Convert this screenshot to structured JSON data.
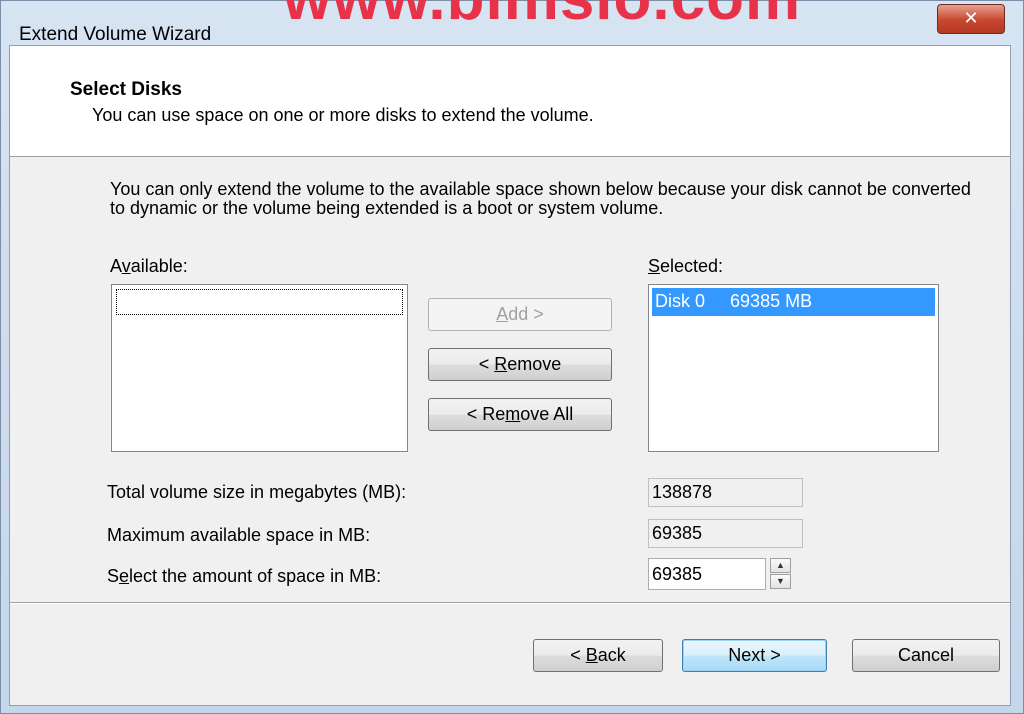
{
  "window": {
    "title": "Extend Volume Wizard",
    "watermark": "www.bimslo.com",
    "close_glyph": "✕"
  },
  "header": {
    "title": "Select Disks",
    "description": "You can use space on one or more disks to extend the volume."
  },
  "info": "You can only extend the volume to the available space shown below because your disk cannot be converted to dynamic or the volume being extended is a boot or system volume.",
  "available": {
    "label_pre": "A",
    "label_key": "v",
    "label_post": "ailable:",
    "items": []
  },
  "selected": {
    "label_key": "S",
    "label_post": "elected:",
    "items": [
      {
        "disk": "Disk 0",
        "size": "69385 MB"
      }
    ]
  },
  "buttons": {
    "add_key": "A",
    "add_post": "dd >",
    "remove_pre": "< ",
    "remove_key": "R",
    "remove_post": "emove",
    "remove_all_pre": "< Re",
    "remove_all_key": "m",
    "remove_all_post": "ove All",
    "back_pre": "< ",
    "back_key": "B",
    "back_post": "ack",
    "next": "Next >",
    "cancel": "Cancel"
  },
  "fields": {
    "total_label": "Total volume size in megabytes (MB):",
    "total_value": "138878",
    "max_label": "Maximum available space in MB:",
    "max_value": "69385",
    "select_label_pre": "S",
    "select_label_key": "e",
    "select_label_post": "lect the amount of space in MB:",
    "select_value": "69385"
  }
}
